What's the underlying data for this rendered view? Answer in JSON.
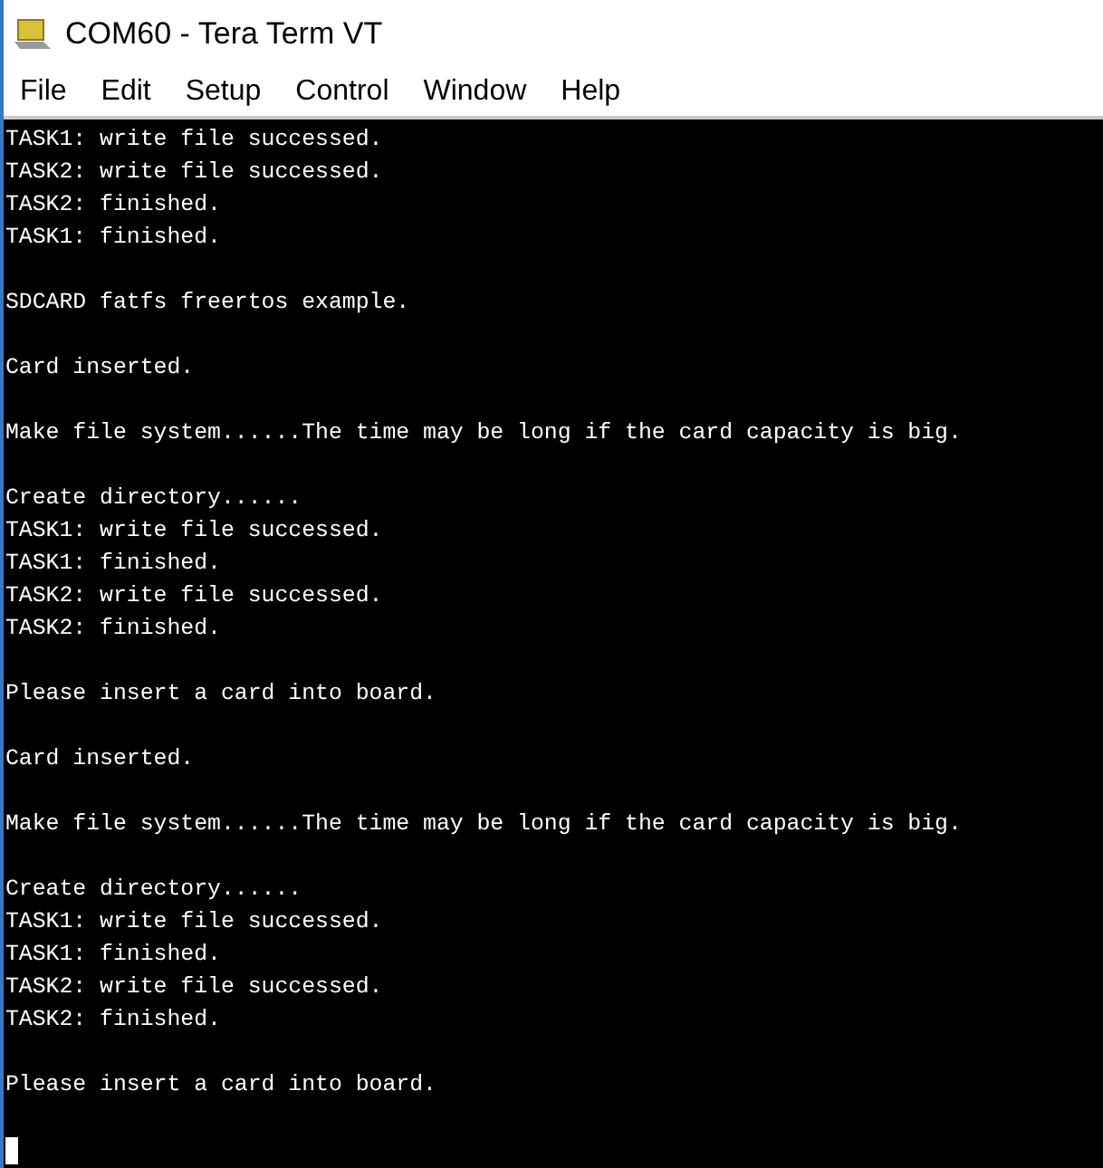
{
  "window": {
    "title": "COM60 - Tera Term VT"
  },
  "menu": [
    {
      "label": "File"
    },
    {
      "label": "Edit"
    },
    {
      "label": "Setup"
    },
    {
      "label": "Control"
    },
    {
      "label": "Window"
    },
    {
      "label": "Help"
    }
  ],
  "terminal": {
    "blocks": [
      {
        "lines": [
          "TASK1: write file successed.",
          "TASK2: write file successed.",
          "TASK2: finished.",
          "TASK1: finished."
        ]
      },
      {
        "lines": [
          "SDCARD fatfs freertos example."
        ]
      },
      {
        "lines": [
          "Card inserted."
        ]
      },
      {
        "lines": [
          "Make file system......The time may be long if the card capacity is big."
        ]
      },
      {
        "lines": [
          "Create directory......",
          "TASK1: write file successed.",
          "TASK1: finished.",
          "TASK2: write file successed.",
          "TASK2: finished."
        ]
      },
      {
        "lines": [
          "Please insert a card into board."
        ]
      },
      {
        "lines": [
          "Card inserted."
        ]
      },
      {
        "lines": [
          "Make file system......The time may be long if the card capacity is big."
        ]
      },
      {
        "lines": [
          "Create directory......",
          "TASK1: write file successed.",
          "TASK1: finished.",
          "TASK2: write file successed.",
          "TASK2: finished."
        ]
      },
      {
        "lines": [
          "Please insert a card into board."
        ]
      }
    ],
    "cursor_visible": true
  }
}
